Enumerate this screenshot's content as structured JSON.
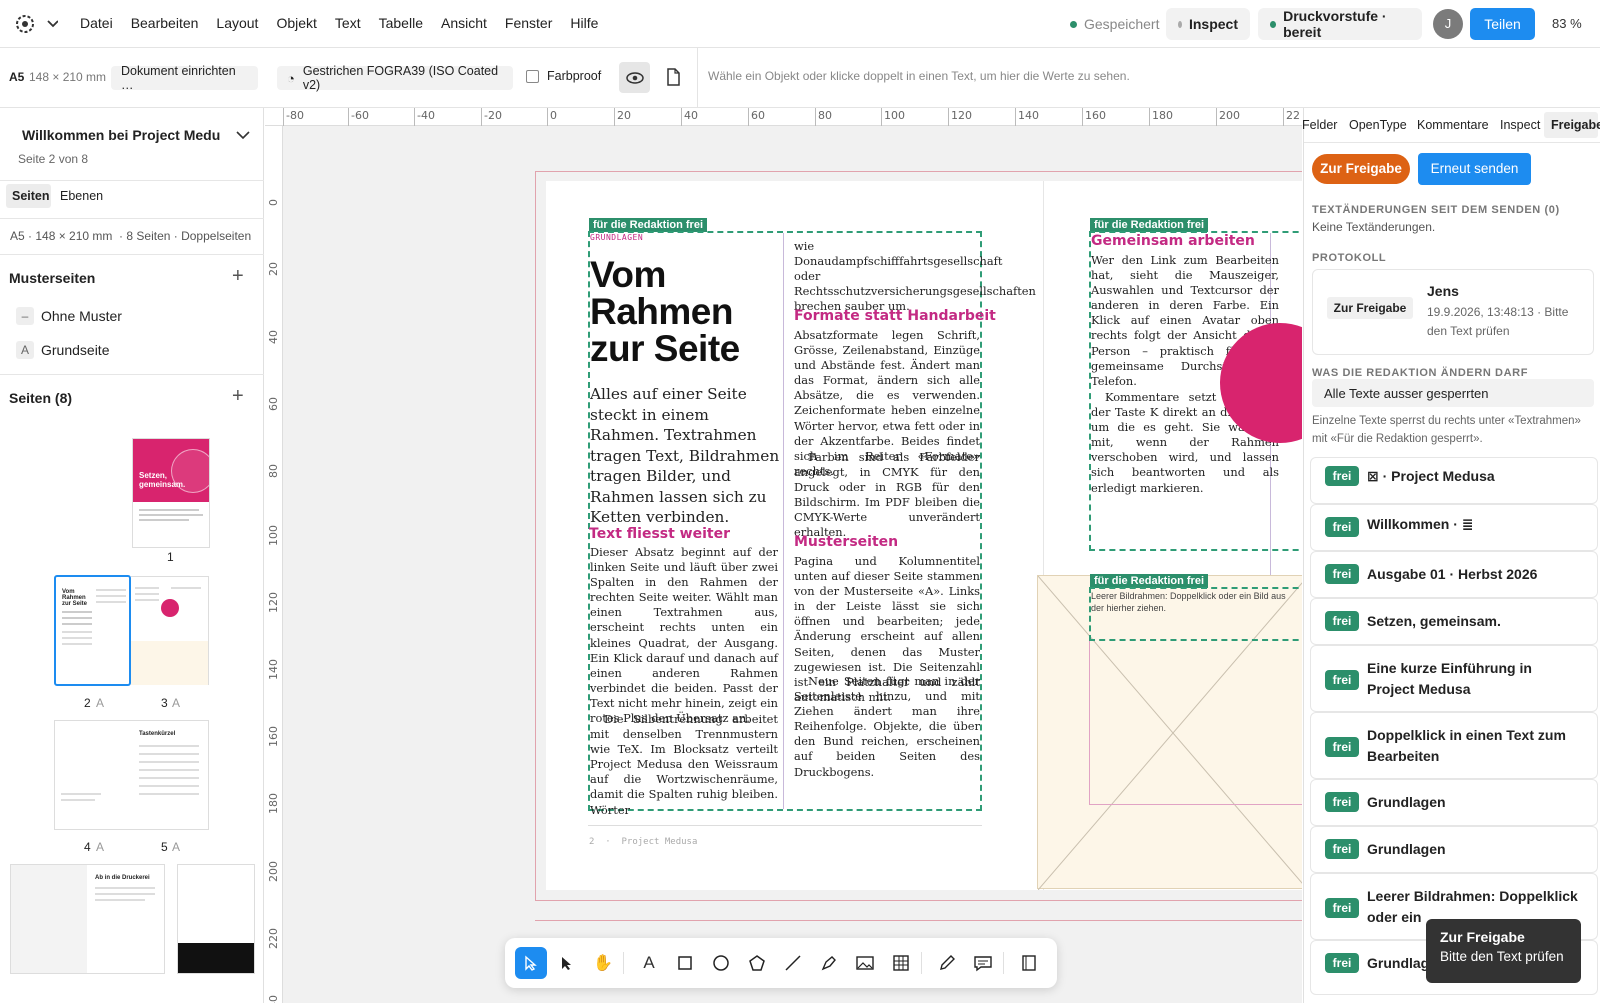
{
  "menubar": {
    "logo_icon": "gear-logo-icon",
    "items": [
      "Datei",
      "Bearbeiten",
      "Layout",
      "Objekt",
      "Text",
      "Tabelle",
      "Ansicht",
      "Fenster",
      "Hilfe"
    ],
    "saved_label": "Gespeichert",
    "inspect_label": "Inspect",
    "status_label": "Druckvorstufe · bereit",
    "avatar_initial": "J",
    "share_label": "Teilen",
    "zoom": "83 %",
    "colors": {
      "accent": "#1d8cf0",
      "green": "#2c8f6b"
    }
  },
  "toolbar": {
    "format_label": "A5",
    "format_size": "148 × 210 mm",
    "setup_label": "Dokument einrichten …",
    "profile_label": "Gestrichen FOGRA39 (ISO Coated v2)",
    "proof_label": "Farbproof",
    "hint": "Wähle ein Objekt oder klicke doppelt in einen Text, um hier die Werte zu sehen."
  },
  "left": {
    "doc_title": "Willkommen bei Project Medu",
    "page_info": "Seite 2 von 8",
    "tabs": [
      "Seiten",
      "Ebenen"
    ],
    "doc_meta": "A5 · 148 × 210 mm  · 8 Seiten · Doppelseiten",
    "master_title": "Musterseiten",
    "masters": [
      {
        "badge": "–",
        "label": "Ohne Muster"
      },
      {
        "badge": "A",
        "label": "Grundseite"
      }
    ],
    "pages_title": "Seiten (8)",
    "page_labels": {
      "p1": "1",
      "p2": "2",
      "p3": "3",
      "p4": "4",
      "p5": "5",
      "m": "A"
    },
    "thumb_text": {
      "cover": "Setzen, gemeinsam.",
      "p2": "Vom Rahmen zur Seite",
      "p5": "Tastenkürzel",
      "p6": "Ab in die Druckerei"
    }
  },
  "ruler": {
    "top": [
      "-80",
      "-60",
      "-40",
      "-20",
      "0",
      "20",
      "40",
      "60",
      "80",
      "100",
      "120",
      "140",
      "160",
      "180",
      "200",
      "22"
    ],
    "left": [
      "0",
      "20",
      "40",
      "60",
      "80",
      "100",
      "120",
      "140",
      "160",
      "180",
      "200",
      "220",
      "240"
    ]
  },
  "spread": {
    "tag": "für die Redaktion frei",
    "kicker": "GRUNDLAGEN",
    "title": "Vom Rahmen zur Seite",
    "lead": "Alles auf einer Seite steckt in einem Rahmen. Textrahmen tragen Text, Bildrahmen tragen Bilder, und Rahmen lassen sich zu Ketten verbinden.",
    "h_text": "Text fliesst weiter",
    "p1": "Dieser Absatz beginnt auf der linken Seite und läuft über zwei Spalten in den Rahmen der rechten Seite weiter. Wählt man einen Textrahmen aus, erscheint rechts unten ein kleines Quadrat, der Ausgang. Ein Klick darauf und danach auf einen anderen Rahmen verbindet die beiden. Passt der Text nicht mehr hinein, zeigt ein rotes Plus den Übersatz an.",
    "p2": "Die Silbentrennung arbeitet mit denselben Trennmustern wie TeX. Im Blocksatz verteilt Project Medusa den Weissraum auf die Wortzwischenräume, damit die Spalten ruhig bleiben. Wörter",
    "col2_top": "wie Donaudampfschifffahrtsgesellschaft oder Rechtsschutzversicherungsgesellschaften brechen sauber um.",
    "h_formats": "Formate statt Handarbeit",
    "p3": "Absatzformate legen Schrift, Grösse, Zeilenabstand, Einzüge und Abstände fest. Ändert man das Format, ändern sich alle Absätze, die es verwenden. Zeichenformate heben einzelne Wörter hervor, etwa fett oder in der Akzentfarbe. Beides findet sich im Reiter «Formate» rechts.",
    "p4": "Farben sind als Farbfelder angelegt, in CMYK für den Druck oder in RGB für den Bildschirm. Im PDF bleiben die CMYK-Werte unverändert erhalten.",
    "h_master": "Musterseiten",
    "p5": "Pagina und Kolumnentitel unten auf dieser Seite stammen von der Musterseite «A». Links in der Leiste lässt sie sich öffnen und bearbeiten; jede Änderung erscheint auf allen Seiten, denen das Muster zugewiesen ist. Die Seitenzahl ist ein Platzhalter und zählt automatisch mit.",
    "p6": "Neue Seiten fügt man in der Seitenleiste hinzu, und mit Ziehen ändert man ihre Reihenfolge. Objekte, die über den Bund reichen, erscheinen auf beiden Seiten des Druckbogens.",
    "footer": "2  ·  Project Medusa",
    "right_head": "Gemeinsam arbeiten",
    "right_p1": "Wer den Link zum Bearbeiten hat, sieht die Mauszeiger, Auswahlen und Textcursor der anderen in deren Farbe. Ein Klick auf einen Avatar oben rechts folgt der Ansicht dieser Person – praktisch für eine gemeinsame Durchsicht am Telefon.",
    "right_p2": "Kommentare setzt man mit der Taste K direkt an die Stelle, um die es geht. Sie wandern mit, wenn der Rahmen verschoben wird, und lassen sich beantworten und als erledigt markieren.",
    "image_hint": "Leerer Bildrahmen: Doppelklick oder ein Bild aus der hierher ziehen."
  },
  "right": {
    "tabs": [
      "Felder",
      "OpenType",
      "Kommentare",
      "Inspect",
      "Freigabe"
    ],
    "approve_label": "Zur Freigabe",
    "resend_label": "Erneut senden",
    "changes_label": "TEXTÄNDERUNGEN SEIT DEM SENDEN (0)",
    "changes_value": "Keine Textänderungen.",
    "protocol_label": "PROTOKOLL",
    "protocol": {
      "user": "Jens",
      "badge": "Zur Freigabe",
      "text": "19.9.2026, 13:48:13 · Bitte den Text prüfen"
    },
    "edit_label": "WAS DIE REDAKTION ÄNDERN DARF",
    "edit_value": "Alle Texte ausser gesperrten",
    "edit_hint": "Einzelne Texte sperrst du rechts unter «Textrahmen» mit «Für die Redaktion gesperrt».",
    "frei_label": "frei",
    "rows": [
      "⊠ · Project Medusa",
      "Willkommen · ≣",
      "Ausgabe 01 · Herbst 2026",
      "Setzen, gemeinsam.",
      "Eine kurze Einführung in Project Medusa",
      "Doppelklick in einen Text zum Bearbeiten",
      "Grundlagen",
      "Grundlagen",
      "Leerer Bildrahmen: Doppelklick oder ein",
      "Grundlag"
    ]
  },
  "tooltip": {
    "title": "Zur Freigabe",
    "text": "Bitte den Text prüfen"
  },
  "tools": [
    "select-icon",
    "direct-select-icon",
    "hand-icon",
    "text-icon",
    "rectangle-icon",
    "ellipse-icon",
    "polygon-icon",
    "line-icon",
    "pen-icon",
    "image-icon",
    "table-icon",
    "pencil-icon",
    "comment-icon",
    "frame-icon"
  ]
}
